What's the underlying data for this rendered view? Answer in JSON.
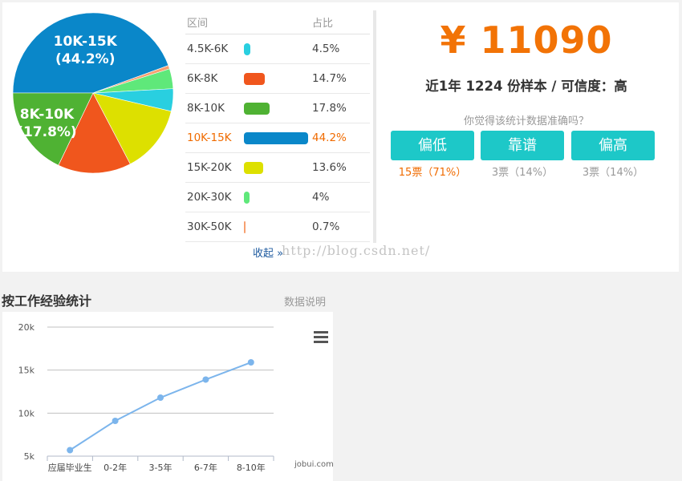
{
  "salary_distribution": {
    "header": {
      "range": "区间",
      "ratio": "占比"
    },
    "rows": [
      {
        "range": "4.5K-6K",
        "pct": "4.5%",
        "value": 4.5,
        "color": "#29cfe0"
      },
      {
        "range": "6K-8K",
        "pct": "14.7%",
        "value": 14.7,
        "color": "#f0561d"
      },
      {
        "range": "8K-10K",
        "pct": "17.8%",
        "value": 17.8,
        "color": "#4fb233"
      },
      {
        "range": "10K-15K",
        "pct": "44.2%",
        "value": 44.2,
        "color": "#0a87c9",
        "active": true
      },
      {
        "range": "15K-20K",
        "pct": "13.6%",
        "value": 13.6,
        "color": "#dde000"
      },
      {
        "range": "20K-30K",
        "pct": "4%",
        "value": 4.0,
        "color": "#5fe87a"
      },
      {
        "range": "30K-50K",
        "pct": "0.7%",
        "value": 0.7,
        "color": "#f7a070"
      }
    ],
    "collapse_label": "收起 »",
    "watermark": "http://blog.csdn.net/"
  },
  "chart_data": [
    {
      "type": "pie",
      "categories": [
        "10K-15K",
        "30K-50K",
        "20K-30K",
        "4.5K-6K",
        "15K-20K",
        "6K-8K",
        "8K-10K"
      ],
      "values": [
        44.2,
        0.7,
        4.0,
        4.5,
        13.6,
        14.7,
        17.8
      ],
      "colors": [
        "#0a87c9",
        "#f7a070",
        "#5fe87a",
        "#29cfe0",
        "#dde000",
        "#f0561d",
        "#4fb233"
      ],
      "labels": [
        {
          "category": "10K-15K",
          "line1": "10K-15K",
          "line2": "(44.2%)"
        },
        {
          "category": "8K-10K",
          "line1": "8K-10K",
          "line2": "(17.8%)"
        }
      ]
    },
    {
      "type": "line",
      "categories": [
        "应届毕业生",
        "0-2年",
        "3-5年",
        "6-7年",
        "8-10年"
      ],
      "values": [
        5700,
        9100,
        11800,
        13900,
        15900
      ],
      "ylim": [
        5000,
        20000
      ],
      "yticks": [
        5000,
        10000,
        15000,
        20000
      ],
      "ytick_labels": [
        "5k",
        "10k",
        "15k",
        "20k"
      ],
      "grid": true,
      "color": "#7cb5ec"
    }
  ],
  "summary": {
    "salary": "¥ 11090",
    "sample_text": "近1年 1224 份样本 / 可信度：高",
    "question": "你觉得该统计数据准确吗？",
    "votes": [
      {
        "label": "偏低",
        "count": "15票（71%）",
        "hot": true
      },
      {
        "label": "靠谱",
        "count": "3票（14%）",
        "hot": false
      },
      {
        "label": "偏高",
        "count": "3票（14%）",
        "hot": false
      }
    ]
  },
  "experience": {
    "title": "按工作经验统计",
    "note": "数据说明",
    "menu_icon": "hamburger-menu-icon",
    "credit": "jobui.com"
  }
}
